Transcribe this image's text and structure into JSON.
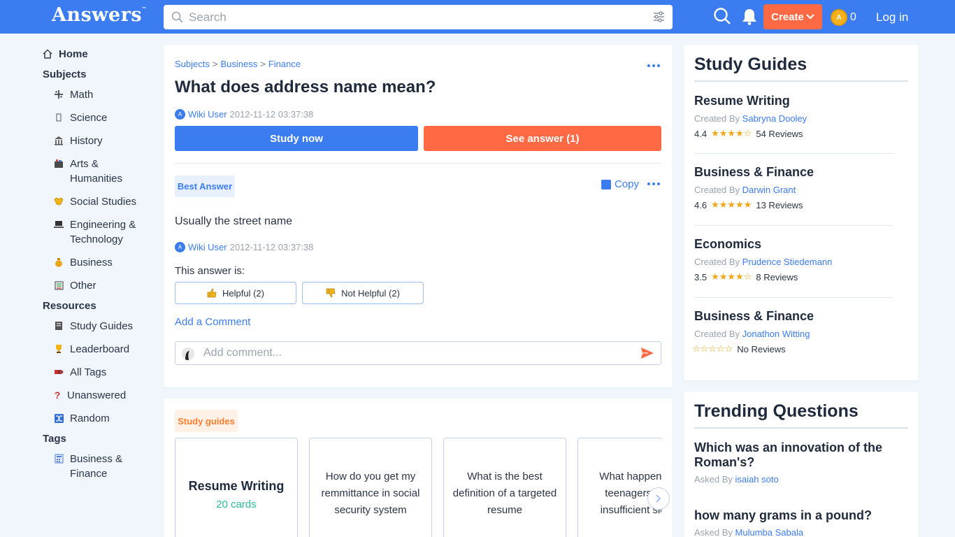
{
  "header": {
    "logo": "Answers",
    "logo_tm": "™",
    "search_placeholder": "Search",
    "create_label": "Create",
    "coin_symbol": "A",
    "coin_count": "0",
    "login_label": "Log in",
    "colors": {
      "bar": "#3b7cf0",
      "create": "#ff6a45"
    }
  },
  "nav": {
    "home": "Home",
    "subjects_heading": "Subjects",
    "subjects": [
      {
        "label": "Math",
        "icon": "math-icon"
      },
      {
        "label": "Science",
        "icon": "science-icon"
      },
      {
        "label": "History",
        "icon": "history-icon"
      },
      {
        "label": "Arts & Humanities",
        "icon": "arts-icon"
      },
      {
        "label": "Social Studies",
        "icon": "social-studies-icon"
      },
      {
        "label": "Engineering & Technology",
        "icon": "engineering-icon"
      },
      {
        "label": "Business",
        "icon": "business-icon"
      },
      {
        "label": "Other",
        "icon": "other-icon"
      }
    ],
    "resources_heading": "Resources",
    "resources": [
      {
        "label": "Study Guides",
        "icon": "study-guides-icon"
      },
      {
        "label": "Leaderboard",
        "icon": "trophy-icon"
      },
      {
        "label": "All Tags",
        "icon": "tags-icon"
      },
      {
        "label": "Unanswered",
        "icon": "question-mark-icon"
      },
      {
        "label": "Random",
        "icon": "shuffle-icon"
      }
    ],
    "tags_heading": "Tags",
    "tags": [
      {
        "label": "Business & Finance",
        "icon": "calculator-icon"
      }
    ]
  },
  "question": {
    "breadcrumb": [
      "Subjects",
      "Business",
      "Finance"
    ],
    "breadcrumb_sep": ">",
    "title": "What does address name mean?",
    "author": "Wiki User",
    "date": "2012-11-12 03:37:38",
    "study_now": "Study now",
    "see_answer": "See answer (1)"
  },
  "answer": {
    "badge": "Best Answer",
    "copy": "Copy",
    "text": "Usually the street name",
    "author": "Wiki User",
    "date": "2012-11-12 03:37:38",
    "this_answer_is": "This answer is:",
    "helpful": "Helpful (2)",
    "not_helpful": "Not Helpful (2)",
    "add_comment": "Add a Comment",
    "comment_placeholder": "Add comment..."
  },
  "study_guides_section": {
    "badge": "Study guides",
    "cards": [
      {
        "title": "Resume Writing",
        "count": "20 cards"
      },
      {
        "title": "How do you get my remmittance in social security system"
      },
      {
        "title": "What is the best definition of a targeted resume"
      },
      {
        "title": "What happens to teenagers with insufficient sleep"
      }
    ]
  },
  "rail_guides": {
    "title": "Study Guides",
    "created_by": "Created By",
    "items": [
      {
        "title": "Resume Writing",
        "creator": "Sabryna Dooley",
        "rating": "4.4",
        "stars": "★★★★☆",
        "reviews": "54 Reviews"
      },
      {
        "title": "Business & Finance",
        "creator": "Darwin Grant",
        "rating": "4.6",
        "stars": "★★★★★",
        "reviews": "13 Reviews"
      },
      {
        "title": "Economics",
        "creator": "Prudence Stiedemann",
        "rating": "3.5",
        "stars": "★★★★☆",
        "reviews": "8 Reviews"
      },
      {
        "title": "Business & Finance",
        "creator": "Jonathon Witting",
        "rating": "",
        "stars": "☆☆☆☆☆",
        "reviews": "No Reviews"
      }
    ]
  },
  "trending": {
    "title": "Trending Questions",
    "asked_by": "Asked By",
    "items": [
      {
        "question": "Which was an innovation of the Roman's?",
        "asker": "isaiah soto"
      },
      {
        "question": "how many grams in a pound?",
        "asker": "Mulumba Sabala"
      }
    ]
  }
}
